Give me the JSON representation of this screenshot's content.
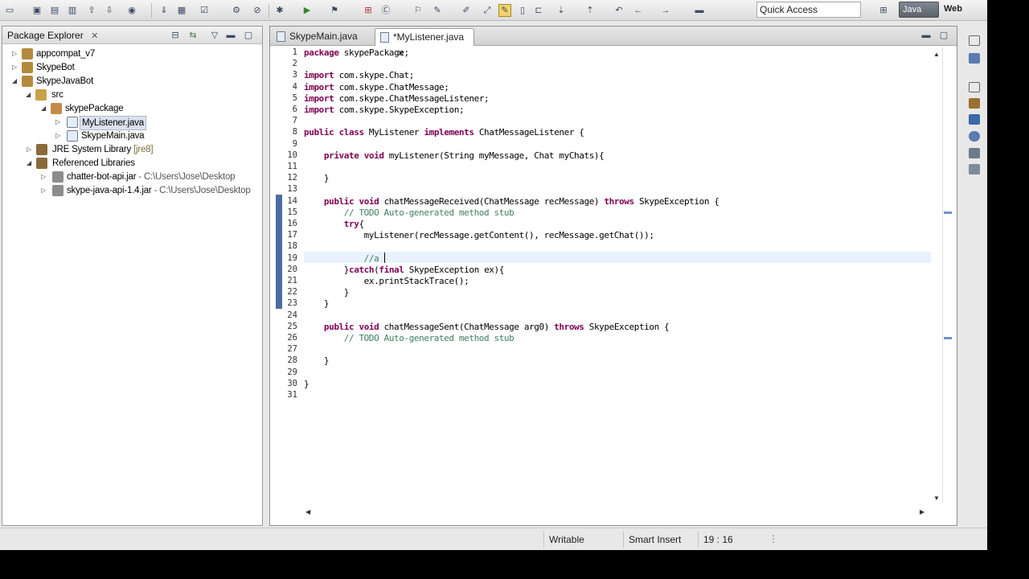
{
  "toolbar": {
    "quick_access": "Quick Access",
    "perspectives": {
      "java": "Java",
      "web": "Web"
    }
  },
  "package_explorer": {
    "title": "Package Explorer",
    "tree": [
      {
        "label": "appcompat_v7",
        "suffix": ""
      },
      {
        "label": "SkypeBot",
        "suffix": ""
      },
      {
        "label": "SkypeJavaBot",
        "suffix": ""
      },
      {
        "label": "src",
        "suffix": ""
      },
      {
        "label": "skypePackage",
        "suffix": ""
      },
      {
        "label": "MyListener.java",
        "suffix": ""
      },
      {
        "label": "SkypeMain.java",
        "suffix": ""
      },
      {
        "label": "JRE System Library",
        "suffix": "[jre8]"
      },
      {
        "label": "Referenced Libraries",
        "suffix": ""
      },
      {
        "label": "chatter-bot-api.jar",
        "suffix": " - C:\\Users\\Jose\\Desktop"
      },
      {
        "label": "skype-java-api-1.4.jar",
        "suffix": " - C:\\Users\\Jose\\Desktop"
      }
    ]
  },
  "editor": {
    "tabs": [
      {
        "label": "SkypeMain.java"
      },
      {
        "label": "*MyListener.java"
      }
    ],
    "lines": [
      {
        "n": "1",
        "text": "package skypePackage;"
      },
      {
        "n": "2",
        "text": ""
      },
      {
        "n": "3",
        "text": "import com.skype.Chat;"
      },
      {
        "n": "4",
        "text": "import com.skype.ChatMessage;"
      },
      {
        "n": "5",
        "text": "import com.skype.ChatMessageListener;"
      },
      {
        "n": "6",
        "text": "import com.skype.SkypeException;"
      },
      {
        "n": "7",
        "text": ""
      },
      {
        "n": "8",
        "text": "public class MyListener implements ChatMessageListener {"
      },
      {
        "n": "9",
        "text": ""
      },
      {
        "n": "10",
        "text": "    private void myListener(String myMessage, Chat myChats){"
      },
      {
        "n": "11",
        "text": ""
      },
      {
        "n": "12",
        "text": "    }"
      },
      {
        "n": "13",
        "text": ""
      },
      {
        "n": "14",
        "text": "    public void chatMessageReceived(ChatMessage recMessage) throws SkypeException {"
      },
      {
        "n": "15",
        "text": "        // TODO Auto-generated method stub"
      },
      {
        "n": "16",
        "text": "        try{"
      },
      {
        "n": "17",
        "text": "            myListener(recMessage.getContent(), recMessage.getChat());"
      },
      {
        "n": "18",
        "text": ""
      },
      {
        "n": "19",
        "text": "            //a"
      },
      {
        "n": "20",
        "text": "        }catch(final SkypeException ex){"
      },
      {
        "n": "21",
        "text": "            ex.printStackTrace();"
      },
      {
        "n": "22",
        "text": "        }"
      },
      {
        "n": "23",
        "text": "    }"
      },
      {
        "n": "24",
        "text": ""
      },
      {
        "n": "25",
        "text": "    public void chatMessageSent(ChatMessage arg0) throws SkypeException {"
      },
      {
        "n": "26",
        "text": "        // TODO Auto-generated method stub"
      },
      {
        "n": "27",
        "text": ""
      },
      {
        "n": "28",
        "text": "    }"
      },
      {
        "n": "29",
        "text": ""
      },
      {
        "n": "30",
        "text": "}"
      },
      {
        "n": "31",
        "text": ""
      }
    ]
  },
  "statusbar": {
    "writable": "Writable",
    "insert_mode": "Smart Insert",
    "position": "19 : 16"
  }
}
